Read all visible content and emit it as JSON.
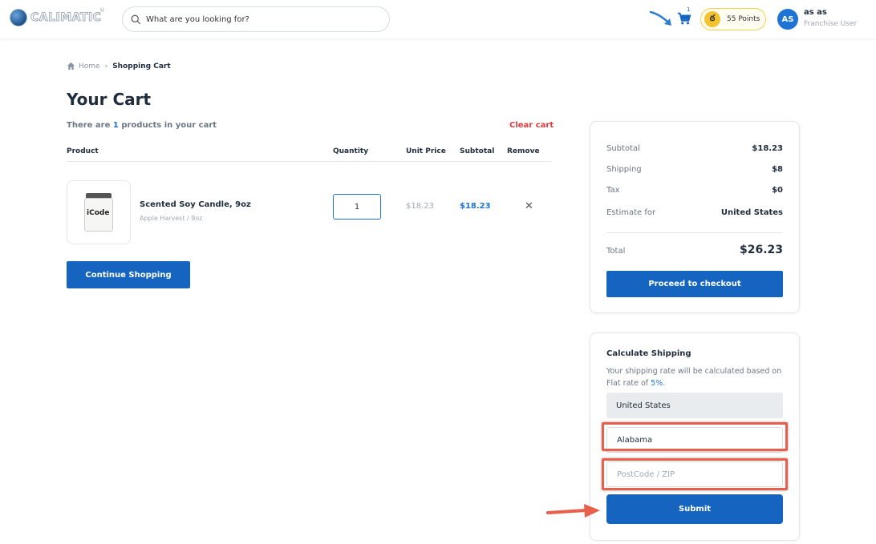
{
  "header": {
    "logo_text": "CALIMATIC",
    "search_placeholder": "What are you looking for?",
    "cart_count": "1",
    "points_label": "55 Points",
    "user_initials": "AS",
    "user_name": "as as",
    "user_role": "Franchise User"
  },
  "breadcrumb": {
    "home": "Home",
    "separator": "›",
    "current": "Shopping Cart"
  },
  "cart": {
    "title": "Your Cart",
    "count_prefix": "There are ",
    "count": "1",
    "count_suffix": " products in your cart",
    "clear_label": "Clear cart",
    "columns": [
      "Product",
      "Quantity",
      "Unit Price",
      "Subtotal",
      "Remove"
    ],
    "item": {
      "image_label": "iCode",
      "name": "Scented Soy Candle, 9oz",
      "variant": "Apple Harvest / 9oz",
      "quantity": "1",
      "unit_price": "$18.23",
      "subtotal": "$18.23",
      "remove_glyph": "✕"
    },
    "continue_label": "Continue Shopping"
  },
  "summary": {
    "subtotal_label": "Subtotal",
    "subtotal_value": "$18.23",
    "shipping_label": "Shipping",
    "shipping_value": "$8",
    "tax_label": "Tax",
    "tax_value": "$0",
    "estimate_label": "Estimate for",
    "estimate_value": "United States",
    "total_label": "Total",
    "total_value": "$26.23",
    "checkout_label": "Proceed to checkout"
  },
  "shipping": {
    "title": "Calculate Shipping",
    "desc_prefix": "Your shipping rate will be calculated based on Flat rate of ",
    "rate": "5%",
    "desc_suffix": ".",
    "country_value": "United States",
    "state_value": "Alabama",
    "zip_placeholder": "PostCode / ZIP",
    "submit_label": "Submit"
  },
  "colors": {
    "primary": "#1565c0",
    "accent_blue": "#1e74d6",
    "danger": "#e23a3a",
    "highlight": "#e8604c",
    "points_yellow": "#f4c430"
  }
}
